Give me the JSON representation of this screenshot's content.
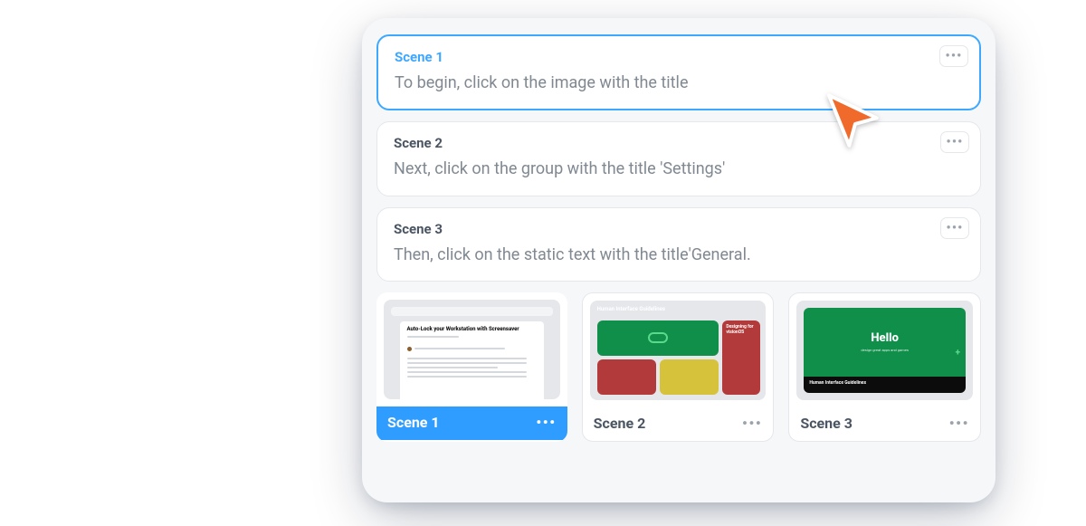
{
  "scenes": [
    {
      "title": "Scene 1",
      "description": "To begin, click on the image with the title",
      "active": true
    },
    {
      "title": "Scene 2",
      "description": "Next, click on the group with the title 'Settings'",
      "active": false
    },
    {
      "title": "Scene 3",
      "description": "Then, click on the static text with the title'General.",
      "active": false
    }
  ],
  "menu_dots": "•••",
  "thumbnails": [
    {
      "label": "Scene 1",
      "selected": true,
      "preview": {
        "kind": "doc",
        "heading": "Auto-Lock your Workstation with Screensaver"
      }
    },
    {
      "label": "Scene 2",
      "selected": false,
      "preview": {
        "kind": "hig-grid",
        "header": "Human Interface Guidelines",
        "side_text": "Designing for visionOS"
      }
    },
    {
      "label": "Scene 3",
      "selected": false,
      "preview": {
        "kind": "hello",
        "text": "Hello",
        "footer": "Human Interface Guidelines"
      }
    }
  ],
  "cursor": {
    "color": "#f06a2b"
  }
}
